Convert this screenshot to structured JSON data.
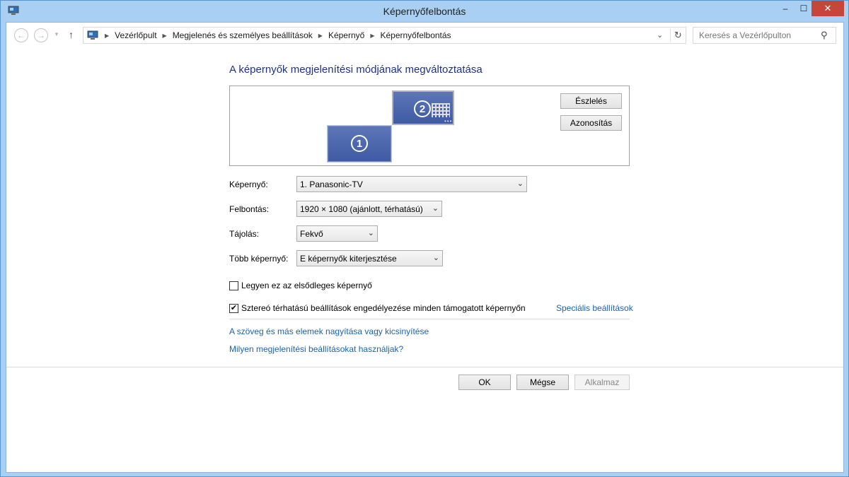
{
  "window": {
    "title": "Képernyőfelbontás",
    "minimize": "–",
    "maximize": "☐",
    "close": "✕"
  },
  "nav": {
    "back_glyph": "←",
    "forward_glyph": "→",
    "dropdown_glyph": "▼",
    "up_glyph": "↑",
    "breadcrumbs": [
      "Vezérlőpult",
      "Megjelenés és személyes beállítások",
      "Képernyő",
      "Képernyőfelbontás"
    ],
    "separator_glyph": "▶",
    "address_drop_glyph": "⌄",
    "refresh_glyph": "↻"
  },
  "search": {
    "placeholder": "Keresés a Vezérlőpulton",
    "icon_glyph": "⚲"
  },
  "main": {
    "heading": "A képernyők megjelenítési módjának megváltoztatása",
    "monitors": [
      {
        "number": "1"
      },
      {
        "number": "2"
      }
    ],
    "detect_button": "Észlelés",
    "identify_button": "Azonosítás"
  },
  "fields": {
    "display_label": "Képernyő:",
    "display_value": "1. Panasonic-TV",
    "resolution_label": "Felbontás:",
    "resolution_value": "1920 × 1080 (ajánlott, térhatású)",
    "orientation_label": "Tájolás:",
    "orientation_value": "Fekvő",
    "multiple_label": "Több képernyő:",
    "multiple_value": "E képernyők kiterjesztése",
    "arrow_glyph": "⌄"
  },
  "options": {
    "primary_label": "Legyen ez az elsődleges képernyő",
    "primary_checked": false,
    "stereo_label": "Sztereó térhatású beállítások engedélyezése minden támogatott képernyőn",
    "stereo_checked": true,
    "check_glyph": "✔",
    "advanced_link": "Speciális beállítások"
  },
  "links": {
    "text_size": "A szöveg és más elemek nagyítása vagy kicsinyítése",
    "which_settings": "Milyen megjelenítési beállításokat használjak?"
  },
  "footer": {
    "ok": "OK",
    "cancel": "Mégse",
    "apply": "Alkalmaz"
  }
}
